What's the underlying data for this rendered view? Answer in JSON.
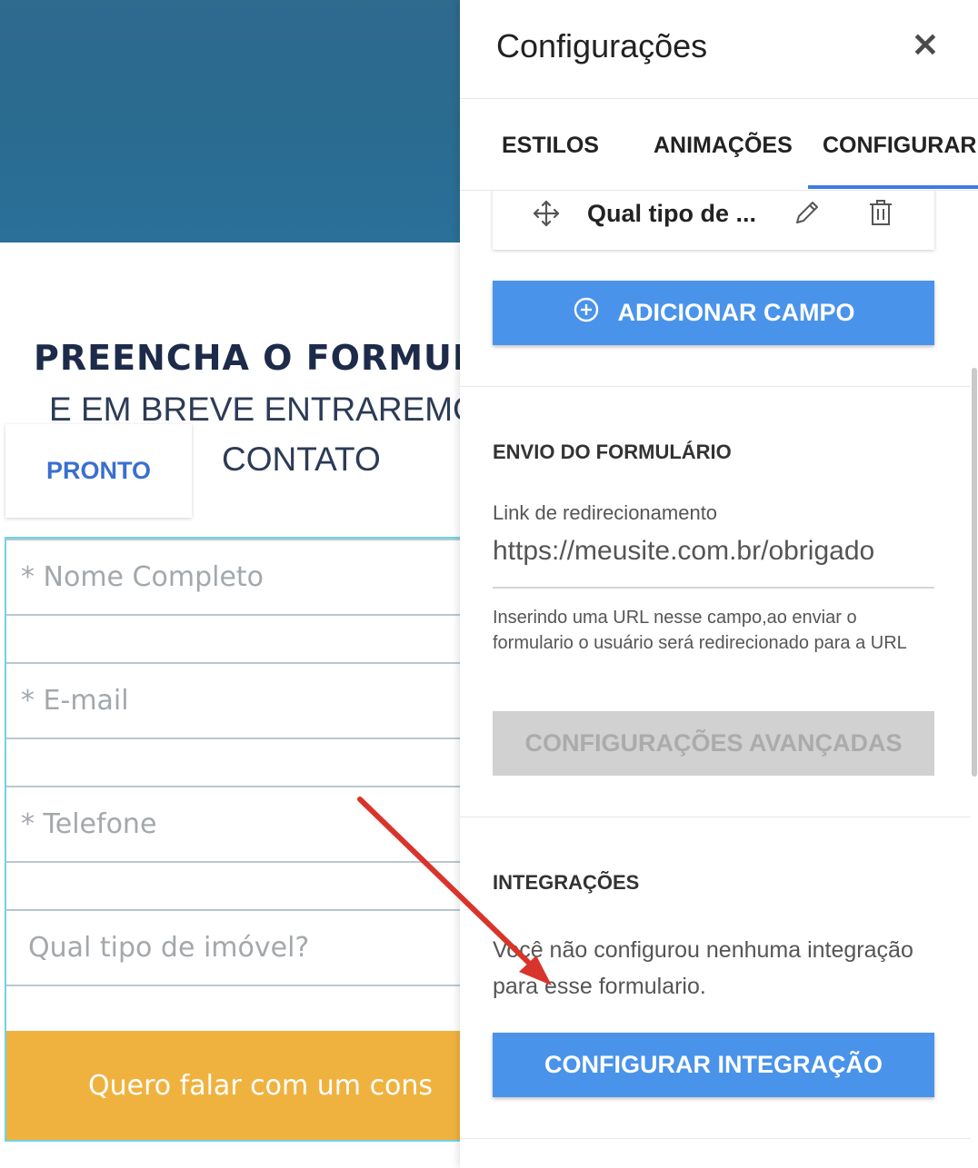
{
  "page": {
    "form_title": "PREENCHA O FORMUL",
    "form_subtitle_line1": "E EM BREVE ENTRAREMO",
    "form_subtitle_line2": "CONTATO",
    "pronto_label": "PRONTO",
    "fields": [
      {
        "placeholder": "* Nome Completo"
      },
      {
        "placeholder": "* E-mail"
      },
      {
        "placeholder": "* Telefone"
      },
      {
        "placeholder": "Qual tipo de imóvel?"
      }
    ],
    "submit_label": "Quero falar com um cons"
  },
  "panel": {
    "title": "Configurações",
    "close_glyph": "✕",
    "tabs": [
      {
        "label": "ESTILOS"
      },
      {
        "label": "ANIMAÇÕES"
      },
      {
        "label": "CONFIGURAR",
        "active": true
      }
    ],
    "field_card": {
      "label": "Qual tipo de ..."
    },
    "add_field_label": "ADICIONAR CAMPO",
    "envio": {
      "title": "ENVIO DO FORMULÁRIO",
      "redirect_label": "Link de redirecionamento",
      "redirect_value": "https://meusite.com.br/obrigado",
      "help": "Inserindo uma URL nesse campo,ao enviar o formulario o usuário será redirecionado para a URL",
      "advanced_label": "CONFIGURAÇÕES AVANÇADAS"
    },
    "integracoes": {
      "title": "INTEGRAÇÕES",
      "empty_text": "Você não configurou nenhuma integração para esse formulario.",
      "button_label": "CONFIGURAR INTEGRAÇÃO"
    }
  },
  "colors": {
    "accent": "#4a93ea",
    "tab_indicator": "#3d7be0",
    "submit": "#f0b23f",
    "arrow": "#d9342b"
  },
  "icons": [
    "close-icon",
    "move-icon",
    "pencil-icon",
    "trash-icon",
    "plus-circle-icon"
  ]
}
